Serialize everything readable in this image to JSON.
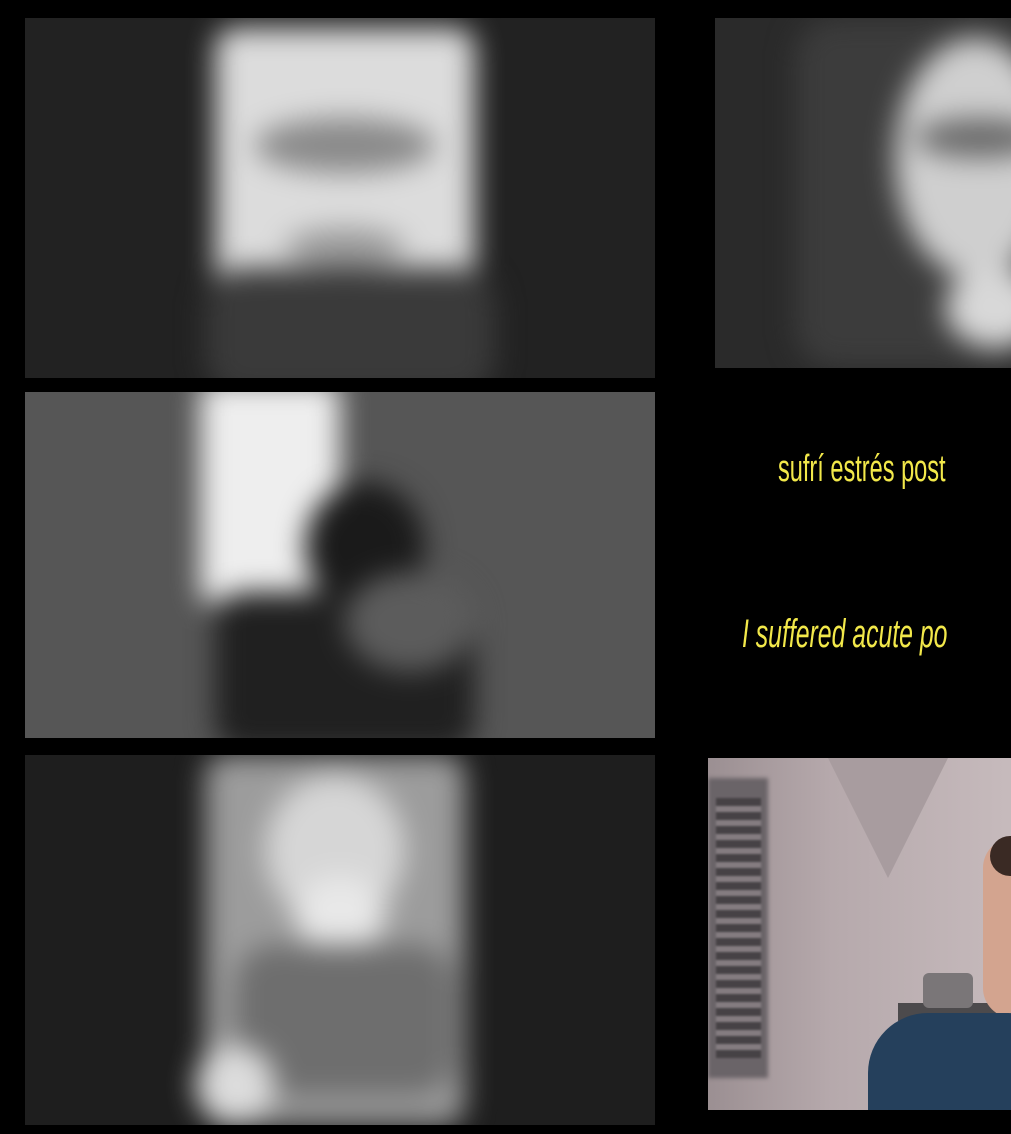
{
  "subtitles": {
    "spanish": "sufrí estrés post",
    "english": "I suffered acute po"
  },
  "participants": [
    {
      "id": "participant-1",
      "video": "blurred-person-glasses"
    },
    {
      "id": "participant-2",
      "video": "blurred-person-glasses-long-hair"
    },
    {
      "id": "participant-3",
      "video": "blurred-person-dark"
    },
    {
      "id": "participant-4",
      "video": "blurred-person-light-shirt"
    },
    {
      "id": "participant-5",
      "video": "color-webcam-room"
    }
  ],
  "colors": {
    "background": "#000000",
    "subtitle": "#f2e84a"
  }
}
